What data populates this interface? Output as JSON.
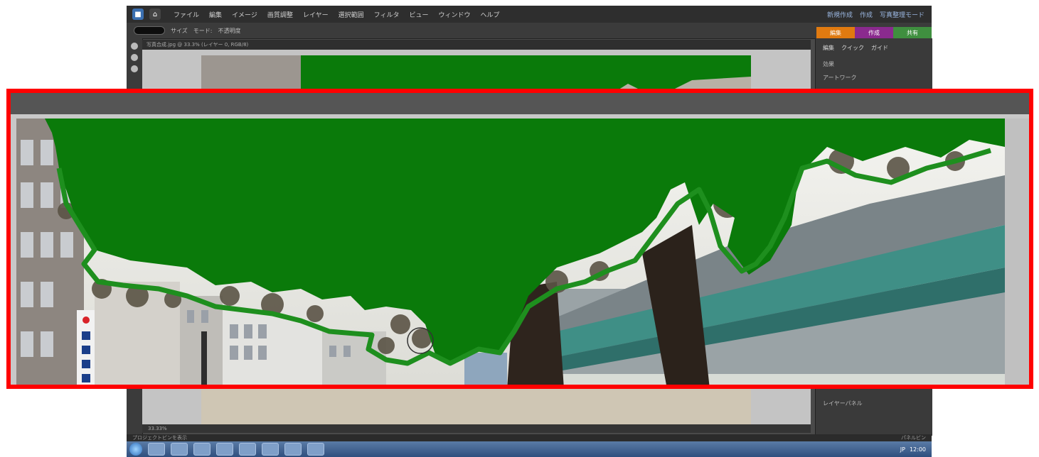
{
  "menubar": {
    "items": [
      "ファイル",
      "編集",
      "イメージ",
      "画質調整",
      "レイヤー",
      "選択範囲",
      "フィルタ",
      "ビュー",
      "ウィンドウ",
      "ヘルプ"
    ],
    "right_items": [
      "新規作成",
      "作成",
      "写真整理モード"
    ]
  },
  "toolbar": {
    "size_label": "サイズ",
    "mode_label": "モード:",
    "opacity_label": "不透明度"
  },
  "mode_tabs": [
    {
      "label": "編集",
      "color": "#e07a10"
    },
    {
      "label": "作成",
      "color": "#8a2a8e"
    },
    {
      "label": "共有",
      "color": "#3f8f3f"
    }
  ],
  "document": {
    "title": "写真合成.jpg @ 33.3% (レイヤー 0, RGB/8)"
  },
  "panel": {
    "tabs": [
      "編集",
      "クイック",
      "ガイド"
    ],
    "section1": "効果",
    "section2": "アートワーク",
    "bottom": "レイヤーパネル"
  },
  "statusbar": {
    "text": "33.33%"
  },
  "bins": {
    "left": "プロジェクトビンを表示",
    "right": "パネルビン"
  },
  "taskbar": {
    "tray_time": "12:00",
    "tray_lang": "JP"
  },
  "colors": {
    "highlight_border": "#ff0000",
    "mask_green": "#0a7a0a",
    "selection_outline": "#1e8f1e"
  }
}
